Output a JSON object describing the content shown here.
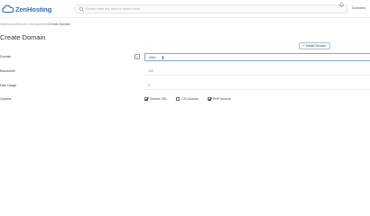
{
  "app": {
    "logo_text": "ZenHosting"
  },
  "header": {
    "search_placeholder": "Please enter any word or search term",
    "account_label": "Domains"
  },
  "breadcrumb": {
    "items": [
      "Dashboard",
      "Domain Management",
      "Create Domain"
    ],
    "separator": "/"
  },
  "page": {
    "title": "Create Domain"
  },
  "toolbar": {
    "install_label": "Install Service"
  },
  "form": {
    "domain": {
      "label": "Domain",
      "value": "willis"
    },
    "bandwidth": {
      "label": "Bandwidth",
      "value": "100"
    },
    "disk_usage": {
      "label": "Disk Usage",
      "value": "0"
    },
    "options": {
      "label": "Options",
      "items": [
        {
          "label": "Secure SSL",
          "checked": true
        },
        {
          "label": "CGI Access",
          "checked": false
        },
        {
          "label": "PHP Access",
          "checked": true
        }
      ]
    }
  },
  "colors": {
    "brand": "#2a6fb0",
    "focus_border": "#7fa8d3"
  }
}
